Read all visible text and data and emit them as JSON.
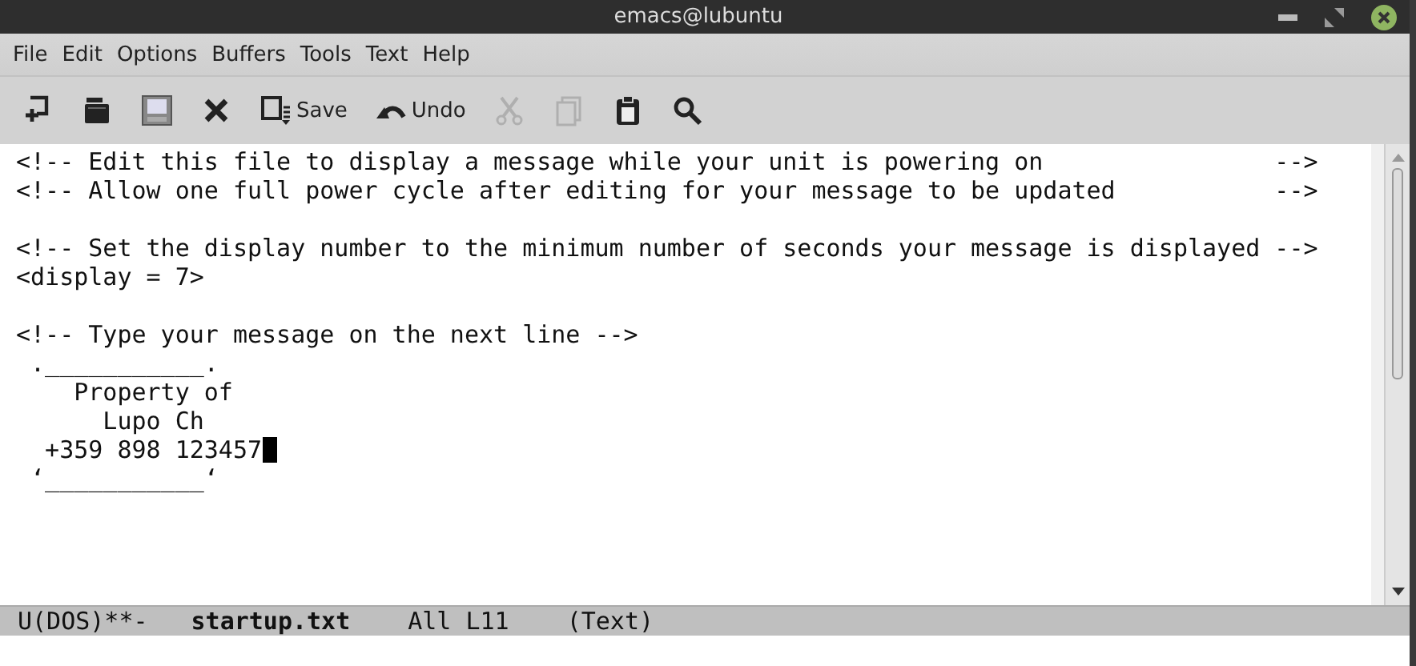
{
  "window": {
    "title": "emacs@lubuntu"
  },
  "menu": [
    "File",
    "Edit",
    "Options",
    "Buffers",
    "Tools",
    "Text",
    "Help"
  ],
  "toolbar": [
    {
      "kind": "new",
      "disabled": false
    },
    {
      "kind": "open",
      "disabled": false
    },
    {
      "kind": "dired",
      "disabled": false
    },
    {
      "kind": "close",
      "disabled": false
    },
    {
      "kind": "save",
      "label": "Save",
      "disabled": false
    },
    {
      "kind": "undo",
      "label": "Undo",
      "disabled": false
    },
    {
      "kind": "cut",
      "disabled": true
    },
    {
      "kind": "copy",
      "disabled": true
    },
    {
      "kind": "paste",
      "disabled": false
    },
    {
      "kind": "search",
      "disabled": false
    }
  ],
  "buffer": {
    "blocks": [
      [
        {
          "text": "<!-- Edit this file to display a message while your unit is powering on                -->",
          "cursor": false
        },
        {
          "text": "<!-- Allow one full power cycle after editing for your message to be updated           -->",
          "cursor": false
        }
      ],
      [
        {
          "text": "<!-- Set the display number to the minimum number of seconds your message is displayed -->",
          "cursor": false
        },
        {
          "text": "<display = 7>",
          "cursor": false
        }
      ],
      [
        {
          "text": "<!-- Type your message on the next line -->",
          "cursor": false
        },
        {
          "text": " .___________.",
          "cursor": false
        },
        {
          "text": "    Property of",
          "cursor": false
        },
        {
          "text": "      Lupo Ch",
          "cursor": false
        },
        {
          "text": "  +359 898 123457",
          "cursor": true
        },
        {
          "text": " ‘___________‘",
          "cursor": false
        }
      ]
    ]
  },
  "mode_line": {
    "status": "U(DOS)**-",
    "buffer_name": "startup.txt",
    "position": "All L11",
    "mode": "(Text)"
  }
}
